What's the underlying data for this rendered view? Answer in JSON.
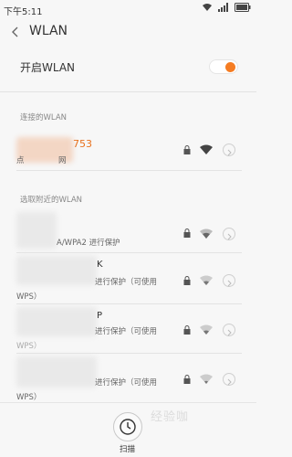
{
  "status_bar": {
    "time": "下午5:11"
  },
  "header": {
    "title": "WLAN"
  },
  "toggle_row": {
    "label": "开启WLAN",
    "state": "on",
    "accent": "#f57c22"
  },
  "connected": {
    "section_label": "连接的WLAN",
    "network": {
      "name_visible": "753",
      "sub_visible": "点",
      "sub_visible_end": "网",
      "name_color": "#e8711d"
    }
  },
  "nearby": {
    "section_label": "选取附近的WLAN",
    "networks": [
      {
        "name_visible": "",
        "sub_visible": "A/WPA2 进行保护"
      },
      {
        "name_visible": "K",
        "sub_visible": "进行保护（可使用",
        "sub_line2": "WPS）"
      },
      {
        "name_visible": "P",
        "sub_visible": "进行保护（可使用",
        "sub_line2": "WPS）"
      },
      {
        "name_visible": "",
        "sub_visible": "进行保护（可使用",
        "sub_line2": "WPS）"
      }
    ]
  },
  "bottom": {
    "scan_label": "扫描",
    "watermark": "经验咖"
  },
  "icons": {
    "back": "chevron-left-icon",
    "lock": "lock-icon",
    "wifi": "wifi-signal-icon",
    "detail": "detail-arrow-icon",
    "scan": "scan-clock-icon"
  }
}
